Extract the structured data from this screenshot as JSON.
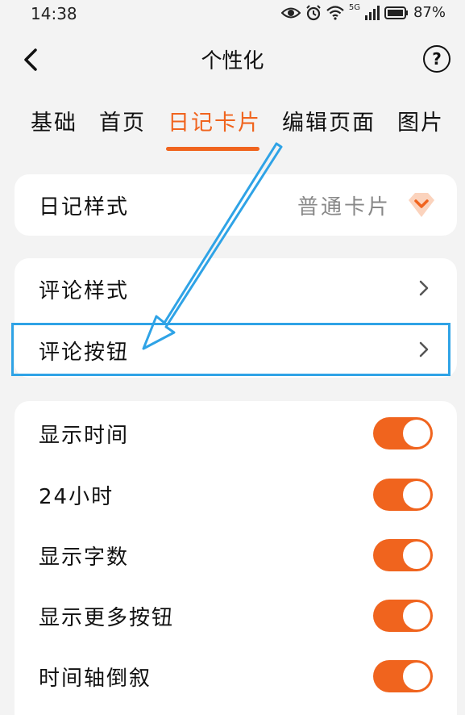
{
  "status_bar": {
    "time": "14:38",
    "network_label": "5G",
    "battery": "87%"
  },
  "header": {
    "title": "个性化",
    "help_symbol": "?"
  },
  "tabs": [
    {
      "label": "基础",
      "active": false
    },
    {
      "label": "首页",
      "active": false
    },
    {
      "label": "日记卡片",
      "active": true
    },
    {
      "label": "编辑页面",
      "active": false
    },
    {
      "label": "图片",
      "active": false
    }
  ],
  "diary_style": {
    "label": "日记样式",
    "value": "普通卡片"
  },
  "comment_group": {
    "items": [
      {
        "label": "评论样式"
      },
      {
        "label": "评论按钮"
      }
    ]
  },
  "toggles": {
    "items": [
      {
        "label": "显示时间",
        "on": true
      },
      {
        "label": "24小时",
        "on": true
      },
      {
        "label": "显示字数",
        "on": true
      },
      {
        "label": "显示更多按钮",
        "on": true
      },
      {
        "label": "时间轴倒叙",
        "on": true
      }
    ]
  },
  "colors": {
    "accent": "#f0641e",
    "annotation": "#2fa3e6"
  },
  "icons": {
    "back": "chevron-left-icon",
    "help": "question-circle-icon",
    "diamond": "diamond-icon",
    "chevron": "chevron-right-icon"
  }
}
